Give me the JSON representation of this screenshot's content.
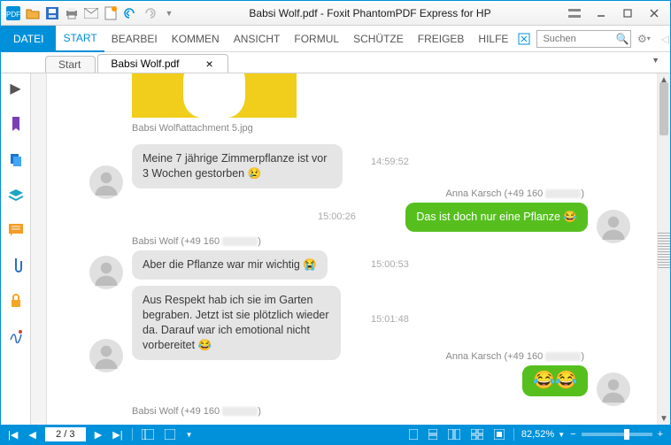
{
  "app": {
    "title": "Babsi Wolf.pdf - Foxit PhantomPDF Express for HP"
  },
  "ribbon": {
    "tabs": {
      "file": "DATEI",
      "start": "START",
      "bearbeiten": "BEARBEI",
      "kommentar": "KOMMEN",
      "ansicht": "ANSICHT",
      "formular": "FORMUL",
      "schuetzen": "SCHÜTZE",
      "freigeben": "FREIGEB",
      "hilfe": "HILFE"
    },
    "search_placeholder": "Suchen"
  },
  "doctabs": {
    "start": "Start",
    "current": "Babsi Wolf.pdf"
  },
  "chat": {
    "attachment_caption": "Babsi Wolf\\attachment 5.jpg",
    "msg1_text": "Meine 7 jährige Zimmerpflanze ist vor  3 Wochen gestorben 😢",
    "msg1_time": "14:59:52",
    "sender_right_1": "Anna Karsch  (+49 160",
    "msg2_text": "Das ist doch nur eine Pflanze 😂",
    "msg2_time": "15:00:26",
    "sender_left_1": "Babsi Wolf  (+49 160",
    "msg3_text": "Aber die Pflanze war mir wichtig   😭",
    "msg3_time": "15:00:53",
    "msg4_text": "Aus Respekt hab ich sie im Garten begraben. Jetzt ist sie plötzlich wieder da. Darauf war ich emotional nicht vorbereitet 😂",
    "msg4_time": "15:01:48",
    "sender_right_2": "Anna Karsch  (+49 160",
    "msg5_text": "😂😂",
    "sender_left_2": "Babsi Wolf  (+49 160"
  },
  "status": {
    "page": "2 / 3",
    "zoom": "82,52%"
  }
}
